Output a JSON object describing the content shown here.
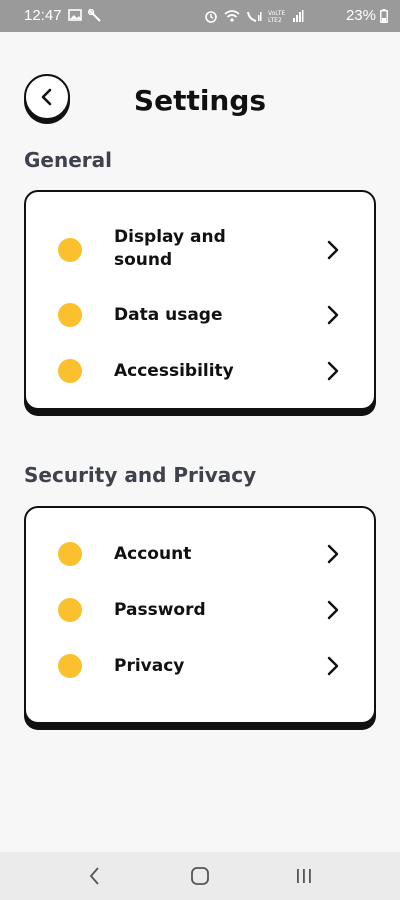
{
  "status_bar": {
    "time": "12:47",
    "battery": "23%",
    "left_icons": [
      "image-icon",
      "wrench-icon"
    ],
    "right_icons": [
      "alarm-icon",
      "wifi-icon",
      "call-signal-icon",
      "volte-icon",
      "signal-icon"
    ]
  },
  "header": {
    "title": "Settings",
    "back_icon": "chevron-left-icon"
  },
  "sections": [
    {
      "title": "General",
      "items": [
        {
          "label": "Display and sound"
        },
        {
          "label": "Data usage"
        },
        {
          "label": "Accessibility"
        }
      ]
    },
    {
      "title": "Security and Privacy",
      "items": [
        {
          "label": "Account"
        },
        {
          "label": "Password"
        },
        {
          "label": "Privacy"
        }
      ]
    }
  ],
  "colors": {
    "accent_dot": "#fbc02d",
    "section_title": "#3f424c",
    "background": "#f7f7f7"
  },
  "nav_bar": {
    "buttons": [
      "back-icon",
      "home-icon",
      "recents-icon"
    ]
  }
}
